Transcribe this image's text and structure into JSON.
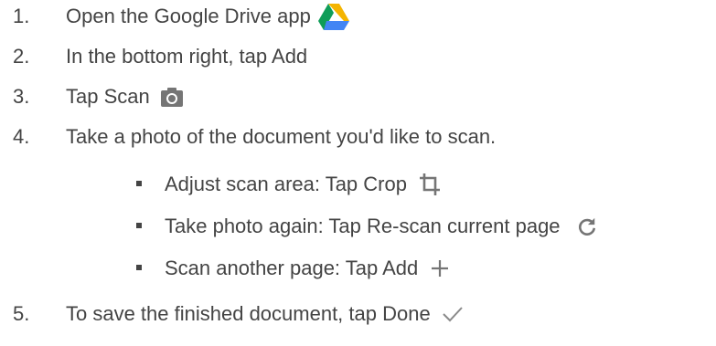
{
  "steps": [
    {
      "number": "1.",
      "text": "Open the Google Drive app",
      "icon": "google-drive-icon"
    },
    {
      "number": "2.",
      "text": "In the bottom right, tap Add"
    },
    {
      "number": "3.",
      "text": "Tap Scan",
      "icon": "camera-icon"
    },
    {
      "number": "4.",
      "text": "Take a photo of the document you'd like to scan."
    },
    {
      "number": "5.",
      "text": "To save the finished document, tap Done",
      "icon": "checkmark-icon"
    }
  ],
  "substeps": [
    {
      "text": "Adjust scan area: Tap Crop",
      "icon": "crop-icon"
    },
    {
      "text": "Take photo again: Tap Re-scan current page",
      "icon": "refresh-icon"
    },
    {
      "text": "Scan another page: Tap Add",
      "icon": "plus-icon"
    }
  ],
  "colors": {
    "text": "#444444",
    "icon_gray": "#757575",
    "drive_green": "#0F9D58",
    "drive_yellow": "#F4B400",
    "drive_blue": "#4285F4"
  }
}
